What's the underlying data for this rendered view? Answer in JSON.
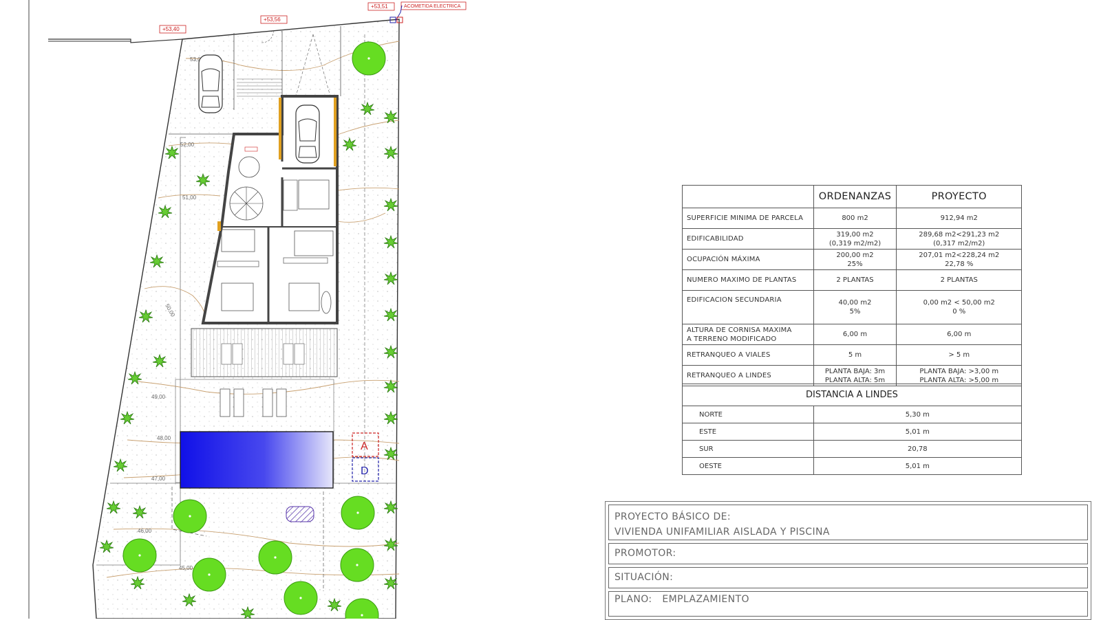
{
  "plan": {
    "levels": [
      "+53,40",
      "+53,56",
      "+53,51"
    ],
    "acometida": "ACOMETIDA ELECTRICA",
    "contours": [
      "53,00",
      "52,00",
      "51,00",
      "50,00",
      "49,00",
      "48,00",
      "47,00",
      "46,00",
      "45,00"
    ],
    "section_marks": [
      "A",
      "D"
    ],
    "colors": {
      "pool": "#2222ee",
      "tree": "#66dd22",
      "section_red": "#cc2222",
      "section_blue": "#2222aa",
      "wall_orange": "#e0a020",
      "contour": "#c8a070"
    }
  },
  "table": {
    "headers": [
      "",
      "ORDENANZAS",
      "PROYECTO"
    ],
    "rows": [
      {
        "label": [
          "SUPERFICIE MINIMA DE PARCELA"
        ],
        "ord": [
          "800 m2"
        ],
        "proy": [
          "912,94 m2"
        ]
      },
      {
        "label": [
          "EDIFICABILIDAD"
        ],
        "ord": [
          "319,00 m2",
          "(0,319 m2/m2)"
        ],
        "proy": [
          "289,68 m2<291,23 m2",
          "(0,317 m2/m2)"
        ]
      },
      {
        "label": [
          "OCUPACIÓN MÁXIMA"
        ],
        "ord": [
          "200,00 m2",
          "25%"
        ],
        "proy": [
          "207,01 m2<228,24 m2",
          "22,78 %"
        ]
      },
      {
        "label": [
          "NUMERO MAXIMO DE PLANTAS"
        ],
        "ord": [
          "2 PLANTAS"
        ],
        "proy": [
          "2 PLANTAS"
        ]
      },
      {
        "label": [
          "EDIFICACION SECUNDARIA"
        ],
        "ord": [
          "40,00 m2",
          "5%"
        ],
        "proy": [
          "0,00 m2 < 50,00 m2",
          "0 %"
        ]
      },
      {
        "label": [
          "ALTURA DE CORNISA MAXIMA",
          "A TERRENO MODIFICADO"
        ],
        "ord": [
          "6,00 m"
        ],
        "proy": [
          "6,00 m"
        ]
      },
      {
        "label": [
          "RETRANQUEO A VIALES"
        ],
        "ord": [
          "5 m"
        ],
        "proy": [
          "> 5 m"
        ]
      },
      {
        "label": [
          "RETRANQUEO A LINDES"
        ],
        "ord": [
          "PLANTA BAJA: 3m",
          "PLANTA ALTA: 5m"
        ],
        "proy": [
          "PLANTA BAJA: >3,00 m",
          "PLANTA ALTA: >5,00 m"
        ]
      }
    ]
  },
  "distancias": {
    "title": "DISTANCIA A LINDES",
    "rows": [
      {
        "label": "NORTE",
        "value": "5,30 m"
      },
      {
        "label": "ESTE",
        "value": "5,01 m"
      },
      {
        "label": "SUR",
        "value": "20,78"
      },
      {
        "label": "OESTE",
        "value": "5,01 m"
      }
    ]
  },
  "title_block": {
    "proyecto_label": "PROYECTO BÁSICO DE:",
    "proyecto_value": "VIVIENDA UNIFAMILIAR AISLADA Y PISCINA",
    "promotor_label": "PROMOTOR:",
    "situacion_label": "SITUACIÓN:",
    "plano_label": "PLANO:",
    "plano_value": "EMPLAZAMIENTO"
  }
}
